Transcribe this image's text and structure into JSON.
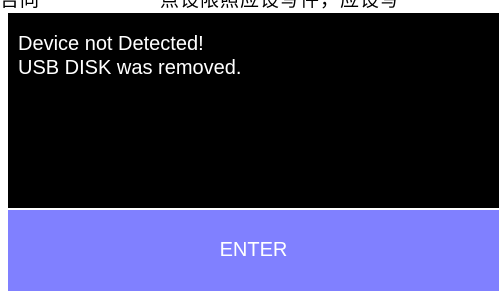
{
  "background_text": "否同　　　　　　点设限照应设写件，应设写",
  "dialog": {
    "line1": "Device not Detected!",
    "line2": "USB DISK was removed.",
    "enter_label": "ENTER"
  },
  "colors": {
    "dialog_background": "#000000",
    "button_background": "#8080ff",
    "text": "#ffffff"
  }
}
